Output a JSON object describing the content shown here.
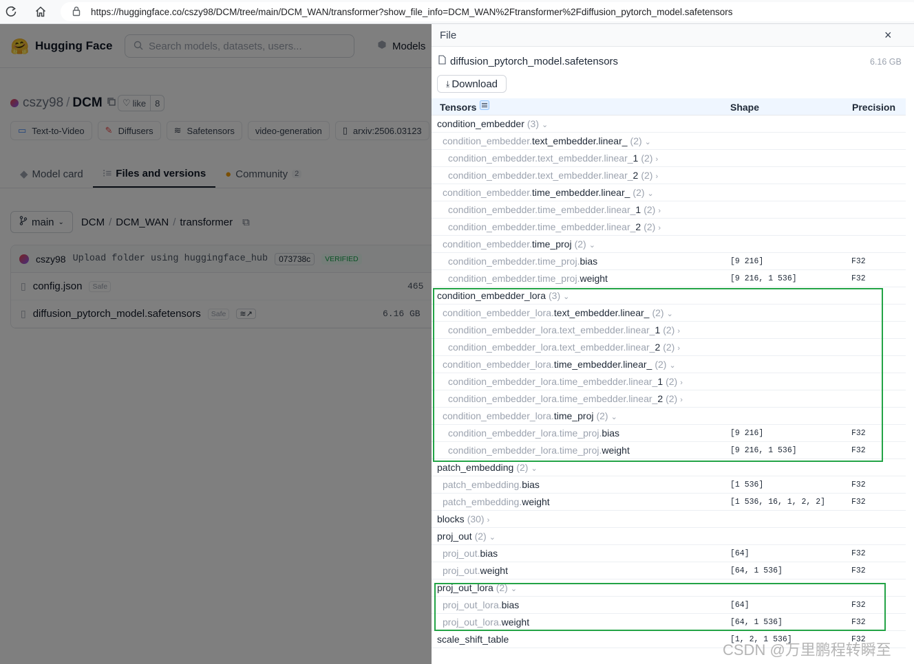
{
  "browser": {
    "url": "https://huggingface.co/cszy98/DCM/tree/main/DCM_WAN/transformer?show_file_info=DCM_WAN%2Ftransformer%2Fdiffusion_pytorch_model.safetensors"
  },
  "header": {
    "brand": "Hugging Face",
    "search_placeholder": "Search models, datasets, users...",
    "models_label": "Models"
  },
  "repo": {
    "owner": "cszy98",
    "name": "DCM",
    "like_label": "like",
    "like_count": "8",
    "tags": [
      "Text-to-Video",
      "Diffusers",
      "Safetensors",
      "video-generation",
      "arxiv:2506.03123"
    ]
  },
  "tabs": [
    {
      "label": "Model card"
    },
    {
      "label": "Files and versions"
    },
    {
      "label": "Community",
      "badge": "2"
    }
  ],
  "branch": {
    "name": "main",
    "path": [
      "DCM",
      "DCM_WAN",
      "transformer"
    ]
  },
  "commit": {
    "user": "cszy98",
    "message": "Upload folder using huggingface_hub",
    "hash": "073738c",
    "verified": "VERIFIED"
  },
  "files": [
    {
      "name": "config.json",
      "safe": "Safe",
      "size": "465"
    },
    {
      "name": "diffusion_pytorch_model.safetensors",
      "safe": "Safe",
      "size": "6.16 GB"
    }
  ],
  "panel": {
    "title": "File",
    "file_name": "diffusion_pytorch_model.safetensors",
    "file_size": "6.16 GB",
    "download_label": "Download",
    "columns": {
      "tensors": "Tensors",
      "shape": "Shape",
      "precision": "Precision"
    },
    "rows": [
      {
        "level": 0,
        "pre": "",
        "suf": "condition_embedder",
        "count": "(3)",
        "chev": "v"
      },
      {
        "level": 1,
        "pre": "condition_embedder.",
        "suf": "text_embedder.linear_",
        "count": "(2)",
        "chev": "v"
      },
      {
        "level": 2,
        "pre": "condition_embedder.text_embedder.linear_",
        "suf": "1",
        "count": "(2)",
        "chev": ">"
      },
      {
        "level": 2,
        "pre": "condition_embedder.text_embedder.linear_",
        "suf": "2",
        "count": "(2)",
        "chev": ">"
      },
      {
        "level": 1,
        "pre": "condition_embedder.",
        "suf": "time_embedder.linear_",
        "count": "(2)",
        "chev": "v"
      },
      {
        "level": 2,
        "pre": "condition_embedder.time_embedder.linear_",
        "suf": "1",
        "count": "(2)",
        "chev": ">"
      },
      {
        "level": 2,
        "pre": "condition_embedder.time_embedder.linear_",
        "suf": "2",
        "count": "(2)",
        "chev": ">"
      },
      {
        "level": 1,
        "pre": "condition_embedder.",
        "suf": "time_proj",
        "count": "(2)",
        "chev": "v"
      },
      {
        "level": 2,
        "pre": "condition_embedder.time_proj.",
        "suf": "bias",
        "shape": "[9 216]",
        "precision": "F32"
      },
      {
        "level": 2,
        "pre": "condition_embedder.time_proj.",
        "suf": "weight",
        "shape": "[9 216, 1 536]",
        "precision": "F32"
      },
      {
        "level": 0,
        "pre": "",
        "suf": "condition_embedder_lora",
        "count": "(3)",
        "chev": "v"
      },
      {
        "level": 1,
        "pre": "condition_embedder_lora.",
        "suf": "text_embedder.linear_",
        "count": "(2)",
        "chev": "v"
      },
      {
        "level": 2,
        "pre": "condition_embedder_lora.text_embedder.linear_",
        "suf": "1",
        "count": "(2)",
        "chev": ">"
      },
      {
        "level": 2,
        "pre": "condition_embedder_lora.text_embedder.linear_",
        "suf": "2",
        "count": "(2)",
        "chev": ">"
      },
      {
        "level": 1,
        "pre": "condition_embedder_lora.",
        "suf": "time_embedder.linear_",
        "count": "(2)",
        "chev": "v"
      },
      {
        "level": 2,
        "pre": "condition_embedder_lora.time_embedder.linear_",
        "suf": "1",
        "count": "(2)",
        "chev": ">"
      },
      {
        "level": 2,
        "pre": "condition_embedder_lora.time_embedder.linear_",
        "suf": "2",
        "count": "(2)",
        "chev": ">"
      },
      {
        "level": 1,
        "pre": "condition_embedder_lora.",
        "suf": "time_proj",
        "count": "(2)",
        "chev": "v"
      },
      {
        "level": 2,
        "pre": "condition_embedder_lora.time_proj.",
        "suf": "bias",
        "shape": "[9 216]",
        "precision": "F32"
      },
      {
        "level": 2,
        "pre": "condition_embedder_lora.time_proj.",
        "suf": "weight",
        "shape": "[9 216, 1 536]",
        "precision": "F32"
      },
      {
        "level": 0,
        "pre": "",
        "suf": "patch_embedding",
        "count": "(2)",
        "chev": "v"
      },
      {
        "level": 1,
        "pre": "patch_embedding.",
        "suf": "bias",
        "shape": "[1 536]",
        "precision": "F32"
      },
      {
        "level": 1,
        "pre": "patch_embedding.",
        "suf": "weight",
        "shape": "[1 536, 16, 1, 2, 2]",
        "precision": "F32"
      },
      {
        "level": 0,
        "pre": "",
        "suf": "blocks",
        "count": "(30)",
        "chev": ">"
      },
      {
        "level": 0,
        "pre": "",
        "suf": "proj_out",
        "count": "(2)",
        "chev": "v"
      },
      {
        "level": 1,
        "pre": "proj_out.",
        "suf": "bias",
        "shape": "[64]",
        "precision": "F32"
      },
      {
        "level": 1,
        "pre": "proj_out.",
        "suf": "weight",
        "shape": "[64, 1 536]",
        "precision": "F32"
      },
      {
        "level": 0,
        "pre": "",
        "suf": "proj_out_lora",
        "count": "(2)",
        "chev": "v"
      },
      {
        "level": 1,
        "pre": "proj_out_lora.",
        "suf": "bias",
        "shape": "[64]",
        "precision": "F32"
      },
      {
        "level": 1,
        "pre": "proj_out_lora.",
        "suf": "weight",
        "shape": "[64, 1 536]",
        "precision": "F32"
      },
      {
        "level": 0,
        "pre": "",
        "suf": "scale_shift_table",
        "shape": "[1, 2, 1 536]",
        "precision": "F32"
      }
    ]
  },
  "watermark": "CSDN @万里鹏程转瞬至",
  "colors": {
    "highlight_box": "#22a345",
    "header_bg": "#eff6ff"
  }
}
